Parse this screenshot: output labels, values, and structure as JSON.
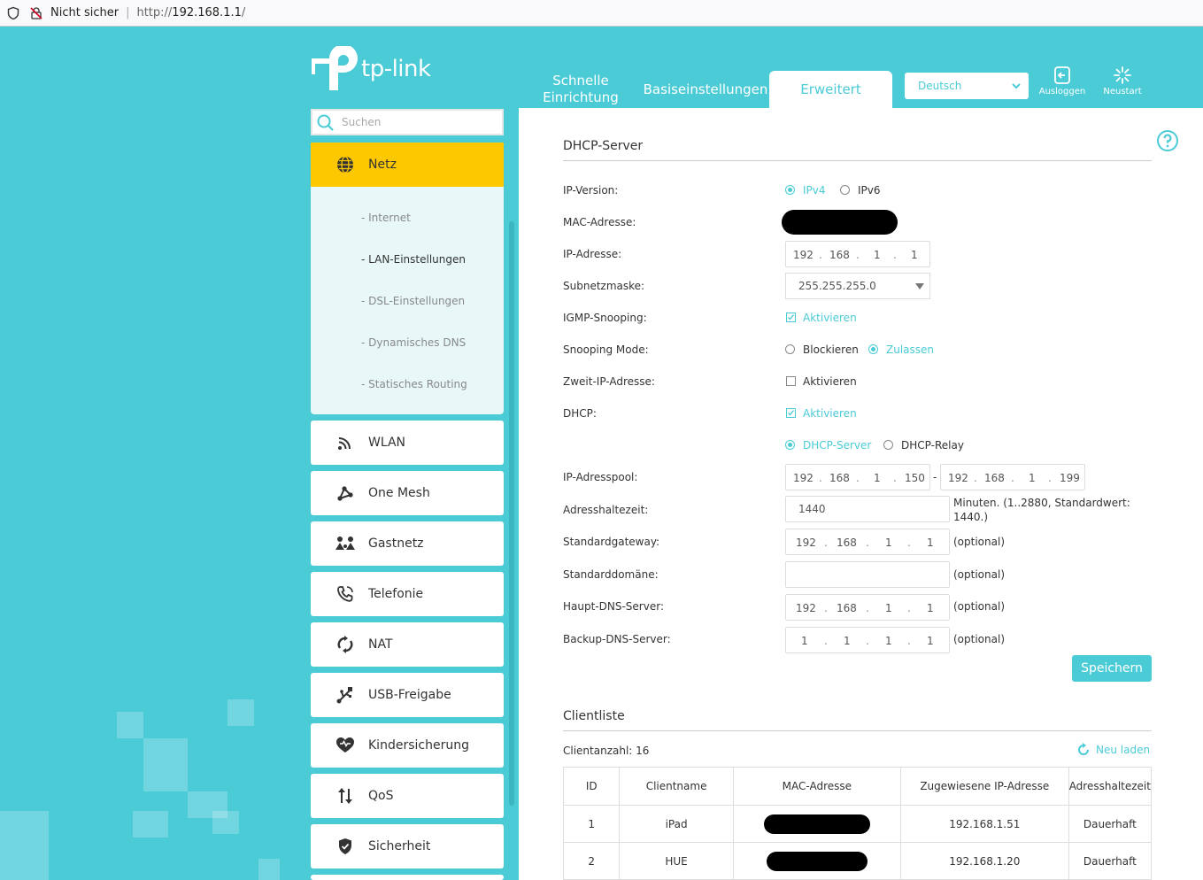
{
  "browser": {
    "security_label": "Nicht sicher",
    "url_prefix": "http://",
    "url_host": "192.168.1.1",
    "url_suffix": "/"
  },
  "brand": {
    "logo_text": "tp-link"
  },
  "topnav": {
    "quick_line1": "Schnelle",
    "quick_line2": "Einrichtung",
    "basic": "Basiseinstellungen",
    "advanced": "Erweitert",
    "language": "Deutsch",
    "logout": "Ausloggen",
    "reboot": "Neustart"
  },
  "search": {
    "placeholder": "Suchen"
  },
  "sidebar": {
    "active": "Netz",
    "submenu": [
      "- Internet",
      "- LAN-Einstellungen",
      "- DSL-Einstellungen",
      "- Dynamisches DNS",
      "- Statisches Routing"
    ],
    "items": [
      "WLAN",
      "One Mesh",
      "Gastnetz",
      "Telefonie",
      "NAT",
      "USB-Freigabe",
      "Kindersicherung",
      "QoS",
      "Sicherheit"
    ]
  },
  "dhcp": {
    "title": "DHCP-Server",
    "labels": {
      "ip_version": "IP-Version:",
      "mac": "MAC-Adresse:",
      "ip": "IP-Adresse:",
      "subnet": "Subnetzmaske:",
      "igmp": "IGMP-Snooping:",
      "snooping_mode": "Snooping Mode:",
      "second_ip": "Zweit-IP-Adresse:",
      "dhcp": "DHCP:",
      "pool": "IP-Adresspool:",
      "lease": "Adresshaltezeit:",
      "gateway": "Standardgateway:",
      "domain": "Standarddomäne:",
      "dns1": "Haupt-DNS-Server:",
      "dns2": "Backup-DNS-Server:"
    },
    "ipv4": "IPv4",
    "ipv6": "IPv6",
    "ip_address": [
      "192",
      "168",
      "1",
      "1"
    ],
    "subnet_mask": "255.255.255.0",
    "igmp_enable": "Aktivieren",
    "block": "Blockieren",
    "allow": "Zulassen",
    "second_ip_enable": "Aktivieren",
    "dhcp_enable": "Aktivieren",
    "dhcp_server": "DHCP-Server",
    "dhcp_relay": "DHCP-Relay",
    "pool_start": [
      "192",
      "168",
      "1",
      "150"
    ],
    "pool_dash": "-",
    "pool_end": [
      "192",
      "168",
      "1",
      "199"
    ],
    "lease_time": "1440",
    "lease_note_line1": "Minuten. (1..2880, Standardwert:",
    "lease_note_line2": "1440.)",
    "gateway_ip": [
      "192",
      "168",
      "1",
      "1"
    ],
    "dns1_ip": [
      "192",
      "168",
      "1",
      "1"
    ],
    "dns2_ip": [
      "1",
      "1",
      "1",
      "1"
    ],
    "optional": "(optional)",
    "save": "Speichern"
  },
  "clients": {
    "title": "Clientliste",
    "count_label": "Clientanzahl: 16",
    "reload": "Neu laden",
    "headers": [
      "ID",
      "Clientname",
      "MAC-Adresse",
      "Zugewiesene IP-Adresse",
      "Adresshaltezeit"
    ],
    "rows": [
      {
        "id": "1",
        "name": "iPad",
        "ip": "192.168.1.51",
        "lease": "Dauerhaft"
      },
      {
        "id": "2",
        "name": "HUE",
        "ip": "192.168.1.20",
        "lease": "Dauerhaft"
      }
    ]
  },
  "colors": {
    "accent": "#4acbd6",
    "active_nav": "#fdc800"
  }
}
